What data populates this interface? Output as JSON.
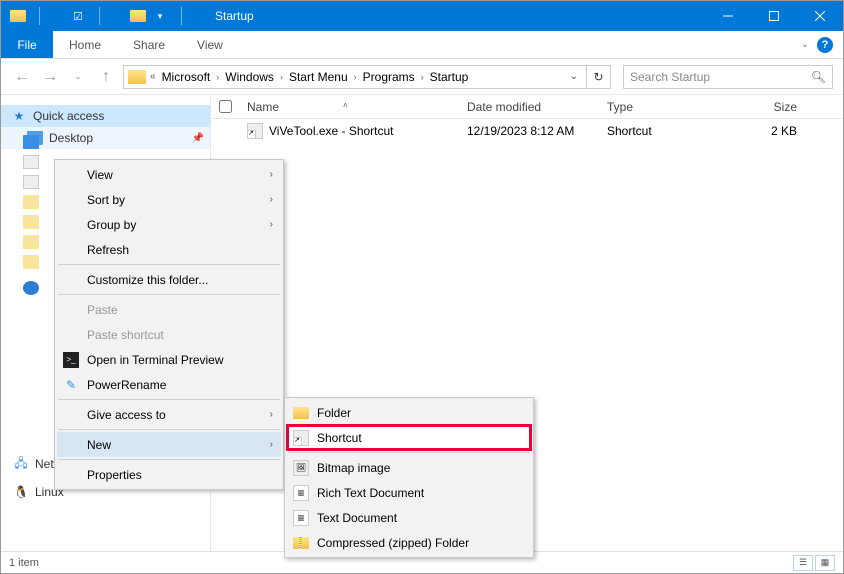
{
  "titlebar": {
    "title": "Startup"
  },
  "ribbon": {
    "file": "File",
    "tabs": [
      "Home",
      "Share",
      "View"
    ]
  },
  "breadcrumb": {
    "segments": [
      "Microsoft",
      "Windows",
      "Start Menu",
      "Programs",
      "Startup"
    ]
  },
  "search": {
    "placeholder": "Search Startup"
  },
  "sidebar": {
    "quick_access": "Quick access",
    "desktop": "Desktop",
    "network": "Network",
    "linux": "Linux"
  },
  "columns": {
    "name": "Name",
    "date": "Date modified",
    "type": "Type",
    "size": "Size"
  },
  "files": [
    {
      "name": "ViVeTool.exe - Shortcut",
      "date": "12/19/2023 8:12 AM",
      "type": "Shortcut",
      "size": "2 KB"
    }
  ],
  "context_menu": {
    "view": "View",
    "sort_by": "Sort by",
    "group_by": "Group by",
    "refresh": "Refresh",
    "customize": "Customize this folder...",
    "paste": "Paste",
    "paste_shortcut": "Paste shortcut",
    "open_terminal": "Open in Terminal Preview",
    "powerrename": "PowerRename",
    "give_access": "Give access to",
    "new": "New",
    "properties": "Properties"
  },
  "submenu": {
    "folder": "Folder",
    "shortcut": "Shortcut",
    "bitmap": "Bitmap image",
    "rtf": "Rich Text Document",
    "text": "Text Document",
    "zip": "Compressed (zipped) Folder"
  },
  "statusbar": {
    "count": "1 item"
  }
}
